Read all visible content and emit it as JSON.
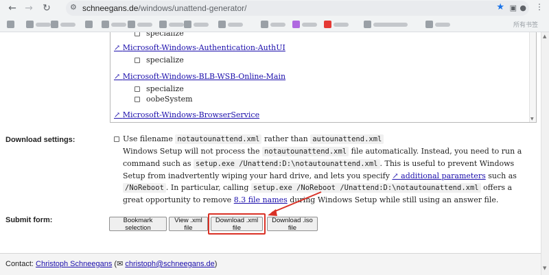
{
  "browser": {
    "url_host": "schneegans.de",
    "url_path": "/windows/unattend-generator/",
    "bookmark_right_label": "所有书签"
  },
  "components": {
    "link_prefix": "↗ ",
    "items": [
      {
        "name": "",
        "passes": [
          "specialize"
        ]
      },
      {
        "name": "Microsoft-Windows-Authentication-AuthUI",
        "passes": [
          "specialize"
        ]
      },
      {
        "name": "Microsoft-Windows-BLB-WSB-Online-Main",
        "passes": [
          "specialize",
          "oobeSystem"
        ]
      },
      {
        "name": "Microsoft-Windows-BrowserService",
        "passes": []
      }
    ]
  },
  "download_settings": {
    "label": "Download settings:",
    "checkbox_text_1": "Use filename",
    "code_1": "notautounattend.xml",
    "checkbox_text_2": "rather than",
    "code_2": "autounattend.xml",
    "p1_a": "Windows Setup will not process the",
    "p1_code": "notautounattend.xml",
    "p1_b": "file automatically. Instead, you need to run a command such as",
    "p1_code2": "setup.exe /Unattend:D:\\notautounattend.xml",
    "p1_c": ". This is useful to prevent Windows Setup from inadvertently wiping your hard drive, and lets you specify",
    "p1_link": "↗ additional parameters",
    "p1_d": "such as",
    "p1_code3": "/NoReboot",
    "p1_e": ". In particular, calling",
    "p1_code4": "setup.exe /NoReboot /Unattend:D:\\notautounattend.xml",
    "p1_f": "offers a great opportunity to remove",
    "p1_link2": "8.3 file names",
    "p1_g": "during Windows Setup while still using an answer file."
  },
  "submit_form": {
    "label": "Submit form:",
    "buttons": {
      "bookmark": "Bookmark selection",
      "view_xml": "View .xml file",
      "download_xml": "Download .xml file",
      "download_iso": "Download .iso file"
    }
  },
  "footer": {
    "contact_label": "Contact:",
    "name": "Christoph Schneegans",
    "open_paren": "(",
    "email_icon": "✉",
    "email": "christoph@schneegans.de",
    "close_paren": ")"
  },
  "colors": {
    "link": "#1a0dab",
    "highlight": "#d93025",
    "star": "#1a73e8"
  }
}
